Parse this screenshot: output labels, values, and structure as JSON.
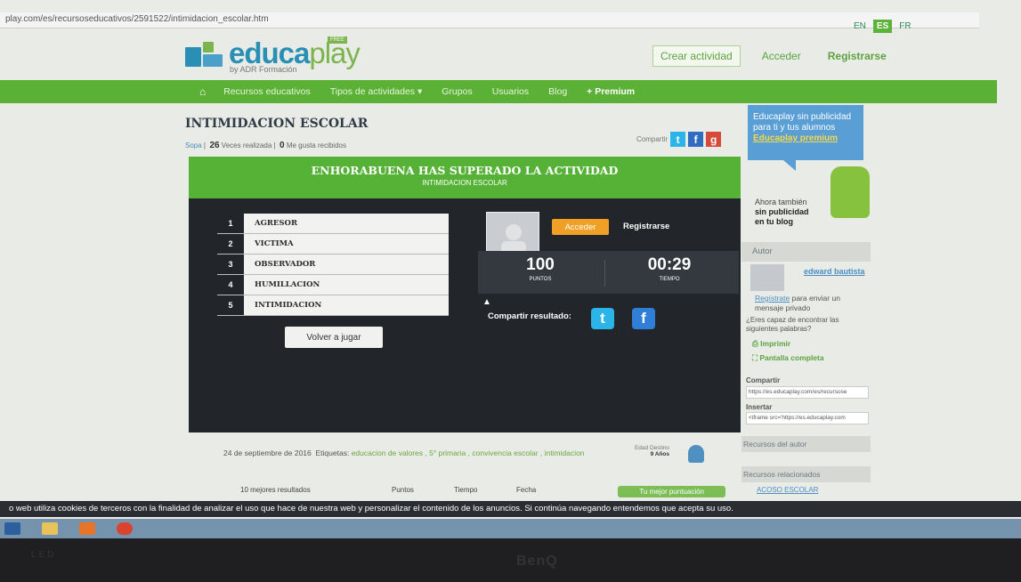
{
  "browser": {
    "url": "play.com/es/recursoseducativos/2591522/intimidacion_escolar.htm"
  },
  "languages": [
    {
      "label": "EN",
      "active": false
    },
    {
      "label": "ES",
      "active": true
    },
    {
      "label": "FR",
      "active": false
    }
  ],
  "logo": {
    "name_edu": "educa",
    "name_play": "play",
    "sub": "by ADR Formación",
    "badge": "FREE"
  },
  "top_nav": {
    "crear": "Crear actividad",
    "acceder": "Acceder",
    "registrarse": "Registrarse"
  },
  "main_nav": {
    "home_icon": "home-icon",
    "items": [
      "Recursos educativos",
      "Tipos de actividades",
      "Grupos",
      "Usuarios",
      "Blog"
    ],
    "premium": "+ Premium"
  },
  "activity": {
    "title": "INTIMIDACION ESCOLAR",
    "type": "Sopa",
    "times": "26",
    "times_label": "Veces realizada",
    "likes": "0",
    "likes_label": "Me gusta recibidos",
    "share_label": "Compartir"
  },
  "result": {
    "congrats": "ENHORABUENA HAS SUPERADO LA ACTIVIDAD",
    "subtitle": "INTIMIDACION ESCOLAR",
    "words": [
      {
        "n": "1",
        "w": "AGRESOR"
      },
      {
        "n": "2",
        "w": "VICTIMA"
      },
      {
        "n": "3",
        "w": "OBSERVADOR"
      },
      {
        "n": "4",
        "w": "HUMILLACION"
      },
      {
        "n": "5",
        "w": "INTIMIDACION"
      }
    ],
    "play_again": "Volver a jugar",
    "acceder": "Acceder",
    "registrarse": "Registrarse",
    "points": "100",
    "points_label": "PUNTOS",
    "time": "00:29",
    "time_label": "TIEMPO",
    "share_result": "Compartir resultado:"
  },
  "meta": {
    "date": "24 de septiembre de 2016",
    "tags_label": "Etiquetas:",
    "tags": "educacion de valores , 5° primaria , convivencia escolar , intimidacion",
    "edad_label": "Edad Destino",
    "edad": "9 Años"
  },
  "results_table": {
    "best": "10 mejores resultados",
    "points": "Puntos",
    "time": "Tiempo",
    "date": "Fecha",
    "yours": "Tu mejor puntuación"
  },
  "sidebar": {
    "ad_line1": "Educaplay sin publicidad",
    "ad_line2": "para ti y tus alumnos",
    "ad_link": "Educaplay premium",
    "noads_1": "Ahora también",
    "noads_2": "sin publicidad",
    "noads_3": "en tu blog",
    "autor_head": "Autor",
    "autor_name": "edward bautista",
    "reg_link": "Regístrate",
    "reg_rest": "para enviar un mensaje privado",
    "question": "¿Eres capaz de encontrar las siguientes palabras?",
    "imprimir": "Imprimir",
    "pantalla": "Pantalla completa",
    "compartir_label": "Compartir",
    "compartir_value": "https://es.educaplay.com/es/recursose",
    "insertar_label": "Insertar",
    "insertar_value": "<iframe src='https://es.educaplay.com",
    "rec_autor": "Recursos del autor",
    "rec_rel": "Recursos relacionados",
    "rel_item": "ACOSO ESCOLAR"
  },
  "cookie": "o web utiliza cookies de terceros con la finalidad de analizar el uso que hace de nuestra web y personalizar el contenido de los anuncios. Si continúa navegando entendemos que acepta su uso.",
  "monitor": {
    "brand": "BenQ",
    "led": "LED"
  },
  "colors": {
    "green": "#5ab136",
    "blue": "#2a8fb4",
    "orange": "#f0a025",
    "dark": "#22262a"
  }
}
